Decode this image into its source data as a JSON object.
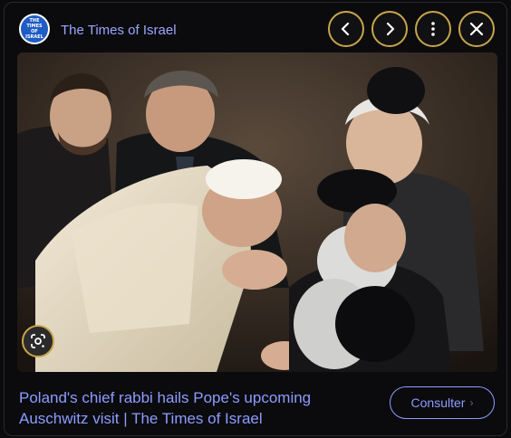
{
  "header": {
    "source_logo_text": "THE TIMES OF ISRAEL",
    "source_name": "The Times of Israel",
    "controls": [
      {
        "name": "previous",
        "icon": "chevron-left-icon"
      },
      {
        "name": "next",
        "icon": "chevron-right-icon"
      },
      {
        "name": "more",
        "icon": "more-vertical-icon"
      },
      {
        "name": "close",
        "icon": "close-icon"
      }
    ]
  },
  "image": {
    "lens_icon": "google-lens-icon"
  },
  "caption": {
    "title": "Poland's chief rabbi hails Pope's upcoming Auschwitz visit | The Times of Israel",
    "visit_label": "Consulter",
    "visit_icon": "chevron-right-icon"
  },
  "colors": {
    "link": "#8c9cff",
    "control_border": "#c9a54a",
    "background": "#0b0b0d"
  }
}
